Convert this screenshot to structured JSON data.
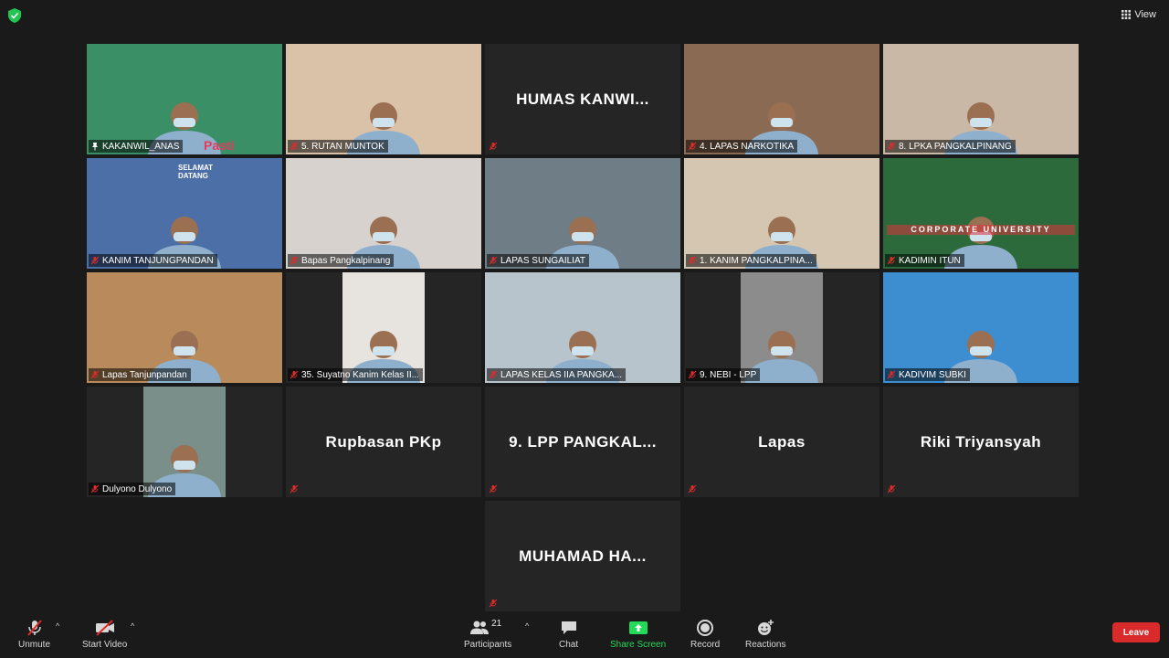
{
  "topbar": {
    "view_label": "View"
  },
  "tiles": [
    {
      "name": "KAKANWIL_ANAS",
      "type": "video",
      "active": true,
      "bg": "#3b8f66",
      "pinned": true
    },
    {
      "name": "5. RUTAN MUNTOK",
      "type": "video",
      "bg": "#d9c2a8"
    },
    {
      "name": "",
      "display_name": "HUMAS  KANWI...",
      "type": "name",
      "muted": true
    },
    {
      "name": "4. LAPAS NARKOTIKA",
      "type": "video",
      "bg": "#8a6a52"
    },
    {
      "name": "8. LPKA PANGKALPINANG",
      "type": "video",
      "bg": "#c9b8a5"
    },
    {
      "name": "KANIM TANJUNGPANDAN",
      "type": "video",
      "bg": "#4d6fa8"
    },
    {
      "name": "Bapas Pangkalpinang",
      "type": "video",
      "bg": "#d8d2cf"
    },
    {
      "name": "LAPAS SUNGAILIAT",
      "type": "video",
      "bg": "#6f7d86"
    },
    {
      "name": "1. KANIM PANGKALPINA...",
      "type": "video",
      "bg": "#d4c6b0"
    },
    {
      "name": "KADIMIN ITUN",
      "type": "video",
      "bg": "#2c6a3b"
    },
    {
      "name": "Lapas Tanjunpandan",
      "type": "video",
      "bg": "#b88a5c"
    },
    {
      "name": "35. Suyatno Kanim Kelas II...",
      "type": "video",
      "bg": "#e7e4df",
      "narrow": true
    },
    {
      "name": "LAPAS KELAS IIA PANGKA...",
      "type": "video",
      "bg": "#b7c4cc"
    },
    {
      "name": "9. NEBI - LPP",
      "type": "video",
      "bg": "#8c8c8c",
      "narrow": true
    },
    {
      "name": "KADIVIM SUBKI",
      "type": "video",
      "bg": "#3d8ed0"
    },
    {
      "name": "Dulyono Dulyono",
      "type": "video",
      "bg": "#7b8f8a",
      "narrow": true
    },
    {
      "name": "",
      "display_name": "Rupbasan PKp",
      "type": "name",
      "muted": true
    },
    {
      "name": "",
      "display_name": "9.  LPP  PANGKAL...",
      "type": "name",
      "muted": true
    },
    {
      "name": "",
      "display_name": "Lapas",
      "type": "name",
      "muted": true
    },
    {
      "name": "",
      "display_name": "Riki Triyansyah",
      "type": "name",
      "muted": true
    },
    {
      "name": "",
      "display_name": "MUHAMAD  HA...",
      "type": "name",
      "muted": true,
      "last": true
    }
  ],
  "video_texts": {
    "selamat": "SELAMAT",
    "datang": "DATANG",
    "corporate": "CORPORATE UNIVERSITY",
    "pasti": "Pasti"
  },
  "toolbar": {
    "unmute": "Unmute",
    "start_video": "Start Video",
    "participants": "Participants",
    "participants_count": "21",
    "chat": "Chat",
    "share_screen": "Share Screen",
    "record": "Record",
    "reactions": "Reactions",
    "leave": "Leave"
  },
  "colors": {
    "active_border": "#c8de55",
    "share_green": "#23d959",
    "leave_red": "#d92b2b",
    "mute_red": "#e02b2b"
  }
}
